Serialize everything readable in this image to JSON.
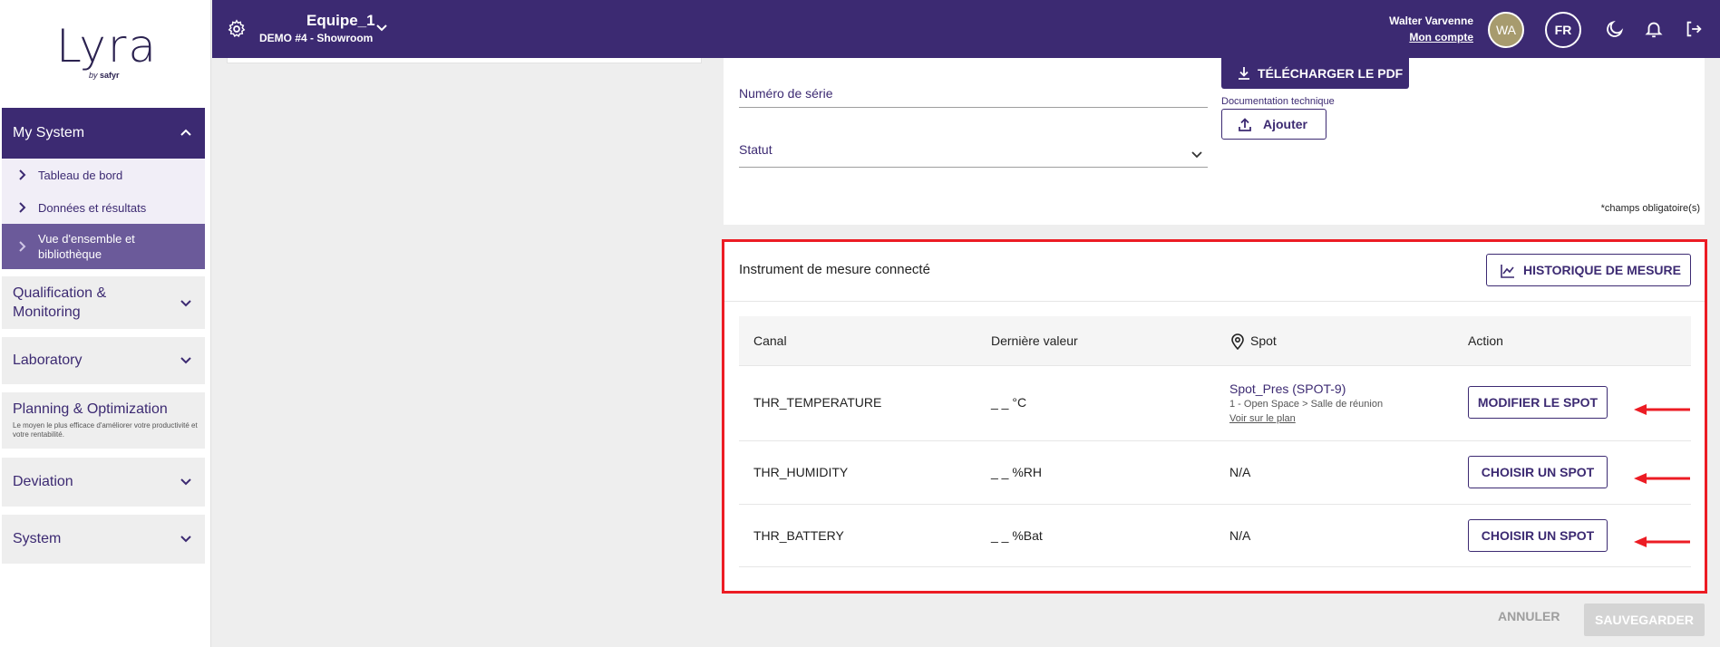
{
  "brand": {
    "logo_text": "Lyra",
    "logo_by": "by",
    "logo_company": "safyr"
  },
  "sidebar": {
    "active_section": "My System",
    "sub_items": [
      {
        "label": "Tableau de bord"
      },
      {
        "label": "Données et résultats"
      },
      {
        "label": "Vue d'ensemble et bibliothèque"
      }
    ],
    "groups": [
      {
        "label": "Qualification & Monitoring"
      },
      {
        "label": "Laboratory"
      },
      {
        "label": "Planning & Optimization",
        "description": "Le moyen le plus efficace d'améliorer votre productivité et votre rentabilité."
      },
      {
        "label": "Deviation"
      },
      {
        "label": "System"
      }
    ]
  },
  "topbar": {
    "title": "Equipe_1",
    "subtitle": "DEMO #4 - Showroom",
    "user_name": "Walter Varvenne",
    "user_link": "Mon compte",
    "avatar_initials": "WA",
    "language": "FR"
  },
  "form": {
    "pdf_button": "TÉLÉCHARGER LE PDF",
    "serial_label": "Numéro de série",
    "doc_label": "Documentation technique",
    "add_button": "Ajouter",
    "status_label": "Statut",
    "required_note": "*champs obligatoire(s)"
  },
  "instrument": {
    "title": "Instrument de mesure connecté",
    "history_button": "HISTORIQUE DE MESURE",
    "columns": {
      "channel": "Canal",
      "last_value": "Dernière valeur",
      "spot": "Spot",
      "action": "Action"
    },
    "rows": [
      {
        "channel": "THR_TEMPERATURE",
        "value": "_ _ °C",
        "spot": "Spot_Pres (SPOT-9)",
        "spot_path": "1 - Open Space > Salle de réunion",
        "spot_link": "Voir sur le plan",
        "action": "MODIFIER LE SPOT"
      },
      {
        "channel": "THR_HUMIDITY",
        "value": "_ _ %RH",
        "spot": "N/A",
        "action": "CHOISIR UN SPOT"
      },
      {
        "channel": "THR_BATTERY",
        "value": "_ _ %Bat",
        "spot": "N/A",
        "action": "CHOISIR UN SPOT"
      }
    ]
  },
  "footer": {
    "cancel": "ANNULER",
    "save": "SAUVEGARDER"
  },
  "colors": {
    "primary": "#3c2a72",
    "active_sub": "#6b5a9a",
    "highlight": "#ec1c24",
    "avatar": "#a79b6e"
  }
}
